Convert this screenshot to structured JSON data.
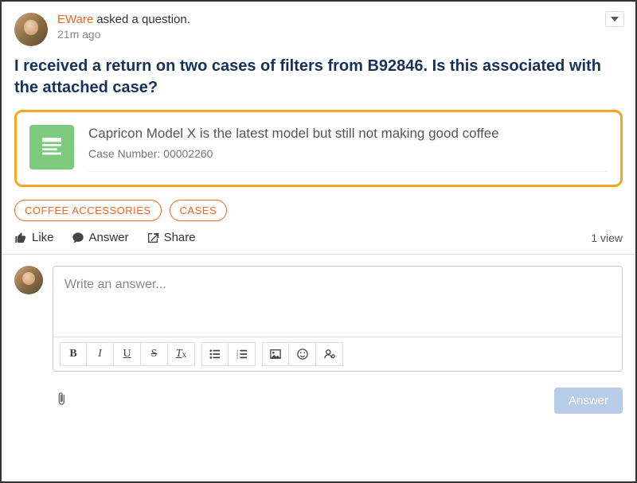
{
  "post": {
    "author": "EWare",
    "action_text": "asked a question.",
    "time": "21m ago",
    "question": "I received a return on two cases of filters from B92846. Is this associated with the attached case?"
  },
  "attachment": {
    "title": "Capricon Model X is the latest model but still not making good coffee",
    "case_label": "Case Number:",
    "case_number": "00002260"
  },
  "tags": [
    "COFFEE ACCESSORIES",
    "CASES"
  ],
  "actions": {
    "like": "Like",
    "answer": "Answer",
    "share": "Share",
    "views": "1 view"
  },
  "editor": {
    "placeholder": "Write an answer...",
    "submit": "Answer"
  }
}
